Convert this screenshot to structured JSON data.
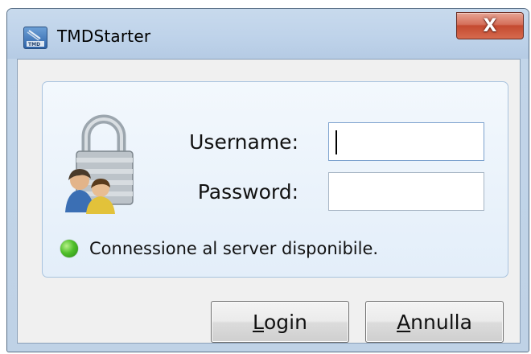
{
  "window": {
    "title": "TMDStarter",
    "close_label": "X"
  },
  "form": {
    "username_label": "Username:",
    "username_value": "",
    "password_label": "Password:",
    "password_value": ""
  },
  "status": {
    "text": "Connessione al server disponibile.",
    "color": "#4fbf2a"
  },
  "buttons": {
    "login_accel": "L",
    "login_rest": "ogin",
    "cancel_accel": "A",
    "cancel_rest": "nnulla"
  },
  "icons": {
    "app": "tmd-app-icon",
    "lock": "lock-users-icon"
  }
}
